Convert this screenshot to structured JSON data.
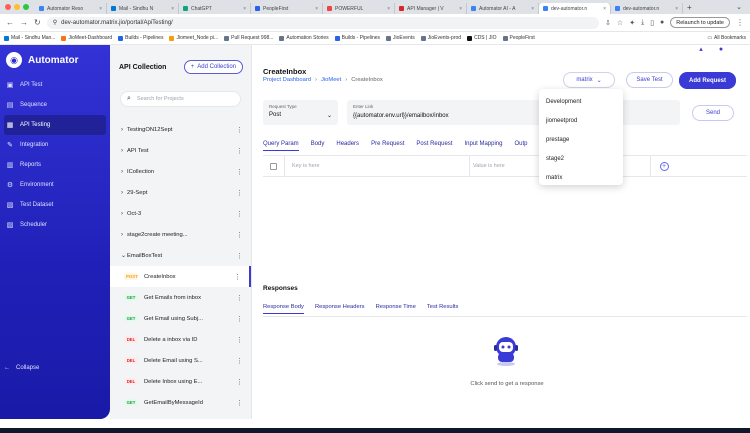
{
  "browser": {
    "tabs": [
      {
        "label": "Automator Reso"
      },
      {
        "label": "Mail - Sindhu N"
      },
      {
        "label": "ChatGPT"
      },
      {
        "label": "PeopleFirst"
      },
      {
        "label": "POWERFUL"
      },
      {
        "label": "API Manager | V"
      },
      {
        "label": "Automator AI - A"
      },
      {
        "label": "dev-automator.n"
      },
      {
        "label": "dev-automator.n"
      }
    ],
    "url": "dev-automator.matrix.jio/portal/ApiTesting/",
    "relaunch_label": "Relaunch to update",
    "bookmarks": [
      "Mail - Sindhu Man...",
      "JioMeet-Dashboard",
      "Builds - Pipelines",
      "Jiomeet_Node pi...",
      "Pull Request 998...",
      "Automation Stories",
      "Builds - Pipelines",
      "JioEvents",
      "JioEvents-prod",
      "CDS | JIO",
      "PeopleFirst"
    ],
    "all_bookmarks_label": "All Bookmarks"
  },
  "sidebar": {
    "brand": "Automator",
    "items": [
      {
        "label": "API Test",
        "icon": "api-icon"
      },
      {
        "label": "Sequence",
        "icon": "sequence-icon"
      },
      {
        "label": "API Testing",
        "icon": "api-testing-icon",
        "active": true
      },
      {
        "label": "Integration",
        "icon": "integration-icon"
      },
      {
        "label": "Reports",
        "icon": "reports-icon"
      },
      {
        "label": "Environment",
        "icon": "gear-icon"
      },
      {
        "label": "Test Dataset",
        "icon": "dataset-icon"
      },
      {
        "label": "Scheduler",
        "icon": "scheduler-icon"
      }
    ],
    "collapse_label": "Collapse"
  },
  "collections": {
    "title": "API Collection",
    "add_label": "Add Collection",
    "search_placeholder": "Search for Projects",
    "groups": [
      {
        "label": "TestingON12Sept"
      },
      {
        "label": "API Test"
      },
      {
        "label": "ICollection"
      },
      {
        "label": "29-Sept"
      },
      {
        "label": "Oct-3"
      },
      {
        "label": "stage2create meeting..."
      },
      {
        "label": "EmailBoxTest"
      }
    ],
    "requests": [
      {
        "method": "POST",
        "label": "CreateInbox"
      },
      {
        "method": "GET",
        "label": "Get Emails from inbox"
      },
      {
        "method": "GET",
        "label": "Get Email using Subj..."
      },
      {
        "method": "DEL",
        "label": "Delete a inbox via ID"
      },
      {
        "method": "DEL",
        "label": "Delete Email using S..."
      },
      {
        "method": "DEL",
        "label": "Delete Inbox using E..."
      },
      {
        "method": "GET",
        "label": "GetEmailByMessageId"
      }
    ]
  },
  "main": {
    "title": "CreateInbox",
    "breadcrumb": [
      "Project Dashboard",
      "JioMeet",
      "CreateInbox"
    ],
    "env_selected": "matrix",
    "save_test_label": "Save Test",
    "add_request_label": "Add Request",
    "request_type_label": "Request Type",
    "request_type_value": "Post",
    "enter_link_label": "Enter Link",
    "link_value": "{{automator.env.url}}/emailbox/inbox",
    "send_label": "Send",
    "request_tabs": [
      "Query Param",
      "Body",
      "Headers",
      "Pre Request",
      "Post Request",
      "Input Mapping",
      "Outp"
    ],
    "key_placeholder": "Key is here",
    "value_placeholder": "Value is here",
    "responses_title": "Responses",
    "response_tabs": [
      "Response Body",
      "Response Headers",
      "Response Time",
      "Test Results"
    ],
    "response_hint": "Click send to get a response"
  },
  "env_dropdown": {
    "options": [
      "Development",
      "jiomeetprod",
      "prestage",
      "stage2",
      "matrix"
    ]
  },
  "colors": {
    "brand": "#3333d6",
    "accent": "#3a3ad6",
    "post": "#f59e0b",
    "get": "#16a34a",
    "del": "#dc2626"
  }
}
